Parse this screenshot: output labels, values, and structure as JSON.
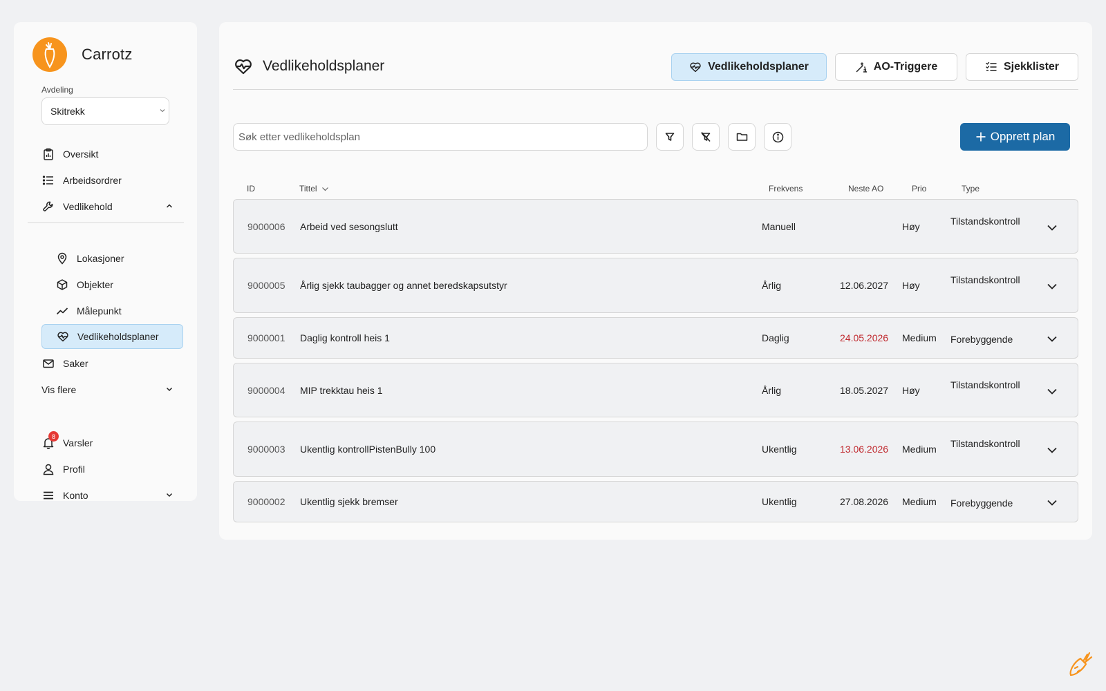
{
  "app": {
    "name": "Carrotz",
    "brand_color": "#f7941d",
    "accent_color": "#1c6aa5"
  },
  "sidebar": {
    "department_label": "Avdeling",
    "department_value": "Skitrekk",
    "items": [
      {
        "label": "Oversikt",
        "icon": "clipboard-chart-icon"
      },
      {
        "label": "Arbeidsordrer",
        "icon": "list-icon"
      },
      {
        "label": "Vedlikehold",
        "icon": "wrench-icon",
        "expanded": true
      },
      {
        "label": "Lokasjoner",
        "icon": "map-pin-icon"
      },
      {
        "label": "Objekter",
        "icon": "cube-icon"
      },
      {
        "label": "Målepunkt",
        "icon": "trend-icon"
      },
      {
        "label": "Vedlikeholdsplaner",
        "icon": "heart-pulse-icon",
        "active": true
      },
      {
        "label": "Saker",
        "icon": "mail-icon"
      },
      {
        "label": "Vis flere"
      }
    ],
    "bottom": [
      {
        "label": "Varsler",
        "icon": "bell-icon",
        "badge": "8"
      },
      {
        "label": "Profil",
        "icon": "user-icon"
      },
      {
        "label": "Konto",
        "icon": "menu-icon"
      }
    ]
  },
  "header": {
    "title": "Vedlikeholdsplaner",
    "tabs": [
      {
        "label": "Vedlikeholdsplaner",
        "active": true
      },
      {
        "label": "AO-Triggere"
      },
      {
        "label": "Sjekklister"
      }
    ]
  },
  "toolbar": {
    "search_placeholder": "Søk etter vedlikeholdsplan",
    "search_value": "",
    "create_label": "Opprett plan"
  },
  "table": {
    "columns": {
      "id": "ID",
      "title": "Tittel",
      "frequency": "Frekvens",
      "next_wo": "Neste AO",
      "priority": "Prio",
      "type": "Type"
    },
    "rows": [
      {
        "id": "9000006",
        "title": "Arbeid ved sesongslutt",
        "frequency": "Manuell",
        "next_wo": "",
        "overdue": false,
        "priority": "Høy",
        "type": "Tilstandskontroll"
      },
      {
        "id": "9000005",
        "title": "Årlig sjekk taubagger og annet beredskapsutstyr",
        "frequency": "Årlig",
        "next_wo": "12.06.2027",
        "overdue": false,
        "priority": "Høy",
        "type": "Tilstandskontroll"
      },
      {
        "id": "9000001",
        "title": "Daglig kontroll heis 1",
        "frequency": "Daglig",
        "next_wo": "24.05.2026",
        "overdue": true,
        "priority": "Medium",
        "type": "Forebyggende"
      },
      {
        "id": "9000004",
        "title": "MIP trekktau heis 1",
        "frequency": "Årlig",
        "next_wo": "18.05.2027",
        "overdue": false,
        "priority": "Høy",
        "type": "Tilstandskontroll"
      },
      {
        "id": "9000003",
        "title": "Ukentlig kontrollPistenBully 100",
        "frequency": "Ukentlig",
        "next_wo": "13.06.2026",
        "overdue": true,
        "priority": "Medium",
        "type": "Tilstandskontroll"
      },
      {
        "id": "9000002",
        "title": "Ukentlig sjekk bremser",
        "frequency": "Ukentlig",
        "next_wo": "27.08.2026",
        "overdue": false,
        "priority": "Medium",
        "type": "Forebyggende"
      }
    ]
  }
}
